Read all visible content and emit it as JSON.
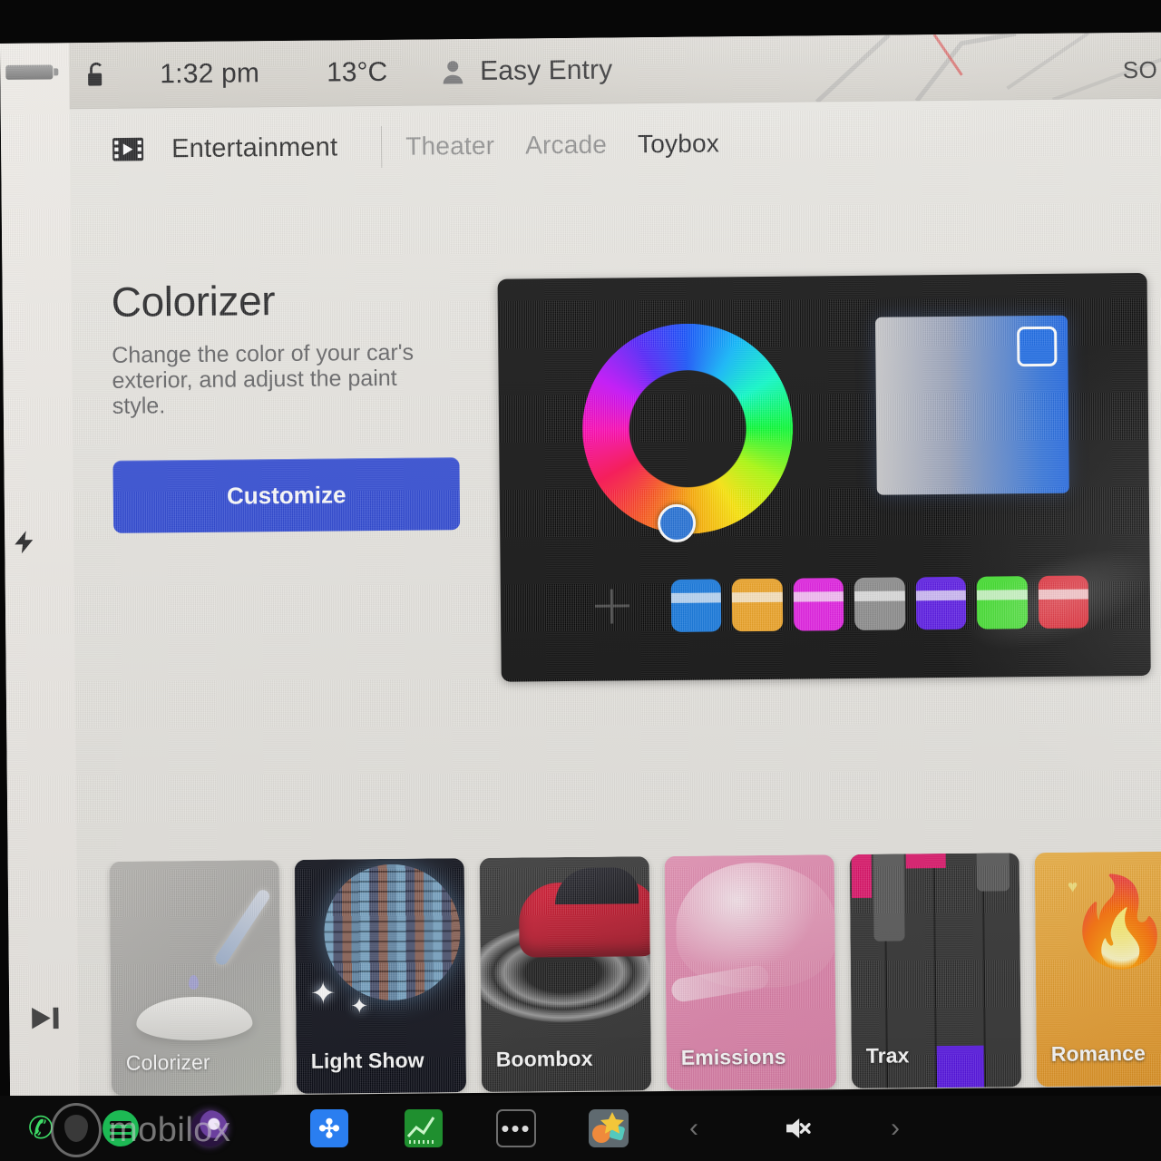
{
  "status_bar": {
    "lock_icon": "unlocked-padlock-icon",
    "time": "1:32 pm",
    "temperature": "13°C",
    "profile_icon": "person-icon",
    "profile_name": "Easy Entry",
    "map_street_label": "SO"
  },
  "left_rail": {
    "battery_icon": "battery-icon",
    "charging_icon": "lightning-bolt-icon",
    "media_icon": "play-skip-icon"
  },
  "tabs": {
    "section_icon": "film-strip-icon",
    "section_label": "Entertainment",
    "items": [
      {
        "label": "Theater",
        "active": false
      },
      {
        "label": "Arcade",
        "active": false
      },
      {
        "label": "Toybox",
        "active": true
      }
    ]
  },
  "detail": {
    "title": "Colorizer",
    "description": "Change the color of your car's exterior, and adjust the paint style.",
    "button_label": "Customize"
  },
  "color_picker": {
    "add_icon": "plus-icon",
    "hue_selector_hue_deg": 225,
    "selected_color": "#1567e6",
    "swatches": [
      {
        "name": "blue",
        "color": "#1177e0"
      },
      {
        "name": "orange",
        "color": "#f0a423"
      },
      {
        "name": "magenta",
        "color": "#e41ce4"
      },
      {
        "name": "gray",
        "color": "#8c8c8c"
      },
      {
        "name": "violet",
        "color": "#5a17e8"
      },
      {
        "name": "green",
        "color": "#39e024"
      },
      {
        "name": "red",
        "color": "#e01b28"
      }
    ]
  },
  "app_cards": [
    {
      "label": "Colorizer",
      "art": "colorizer",
      "selected": true
    },
    {
      "label": "Light Show",
      "art": "lightshow",
      "selected": false
    },
    {
      "label": "Boombox",
      "art": "boombox",
      "selected": false
    },
    {
      "label": "Emissions",
      "art": "emissions",
      "selected": false
    },
    {
      "label": "Trax",
      "art": "trax",
      "selected": false
    },
    {
      "label": "Romance",
      "art": "romance",
      "selected": false
    }
  ],
  "taskbar": {
    "watermark": "mobilox",
    "left_icons": [
      "phone-icon",
      "spotify-icon",
      "camera-icon",
      "bluetooth-icon",
      "energy-chart-icon",
      "more-dots-icon",
      "apps-icon"
    ],
    "bluetooth_glyph": "✣",
    "prev_icon": "chevron-left-icon",
    "next_icon": "chevron-right-icon",
    "volume_icon": "volume-muted-icon",
    "volume_muted": true
  },
  "colors": {
    "accent": "#2a45d4",
    "screen_bg": "#e8e6e1",
    "statusbar_bg": "#d5d2cb",
    "panel_bg": "#050505",
    "taskbar_bg": "#0b0b0b"
  }
}
